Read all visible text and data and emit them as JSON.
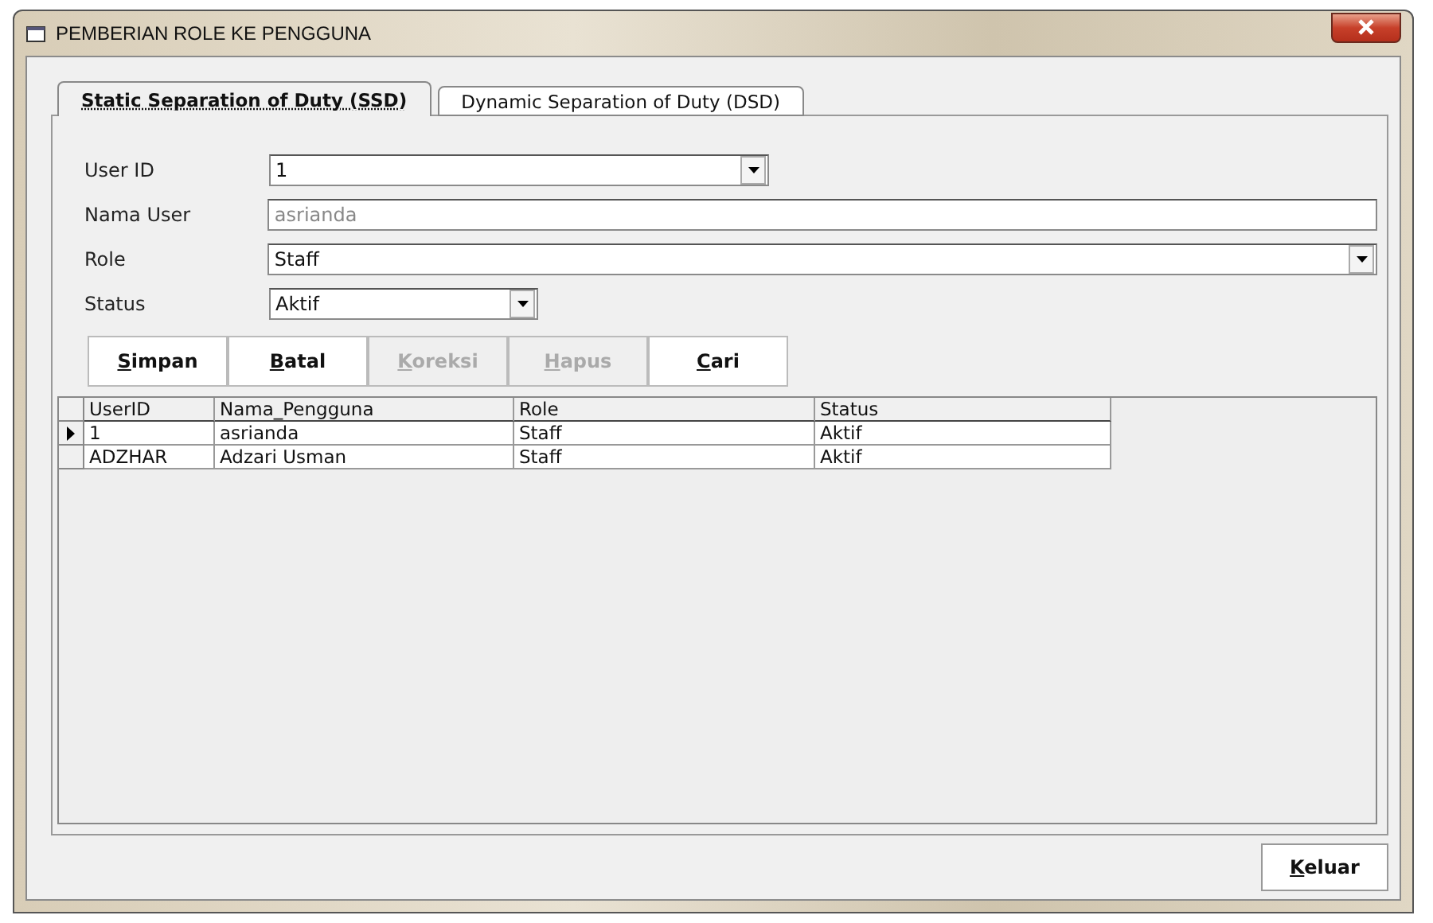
{
  "window": {
    "title": "PEMBERIAN ROLE KE PENGGUNA"
  },
  "tabs": [
    {
      "label": "Static Separation of Duty (SSD)",
      "selected": true
    },
    {
      "label": "Dynamic Separation of Duty (DSD)",
      "selected": false
    }
  ],
  "form": [
    {
      "label": "User ID",
      "value": "1",
      "kind": "combo",
      "disabled": false
    },
    {
      "label": "Nama User",
      "value": "asrianda",
      "kind": "text",
      "disabled": true
    },
    {
      "label": "Role",
      "value": "Staff",
      "kind": "combo",
      "disabled": false
    },
    {
      "label": "Status",
      "value": "Aktif",
      "kind": "combo",
      "disabled": false
    }
  ],
  "buttons": [
    {
      "label": "Simpan",
      "disabled": false
    },
    {
      "label": "Batal",
      "disabled": false
    },
    {
      "label": "Koreksi",
      "disabled": true
    },
    {
      "label": "Hapus",
      "disabled": true
    },
    {
      "label": "Cari",
      "disabled": false
    }
  ],
  "table": {
    "columns": [
      "UserID",
      "Nama_Pengguna",
      "Role",
      "Status"
    ],
    "rows": [
      {
        "cells": [
          "1",
          "asrianda",
          "Staff",
          "Aktif"
        ],
        "selected": true
      },
      {
        "cells": [
          "ADZHAR",
          "Adzari Usman",
          "Staff",
          "Aktif"
        ],
        "selected": false
      }
    ]
  },
  "exit_button": "Keluar"
}
